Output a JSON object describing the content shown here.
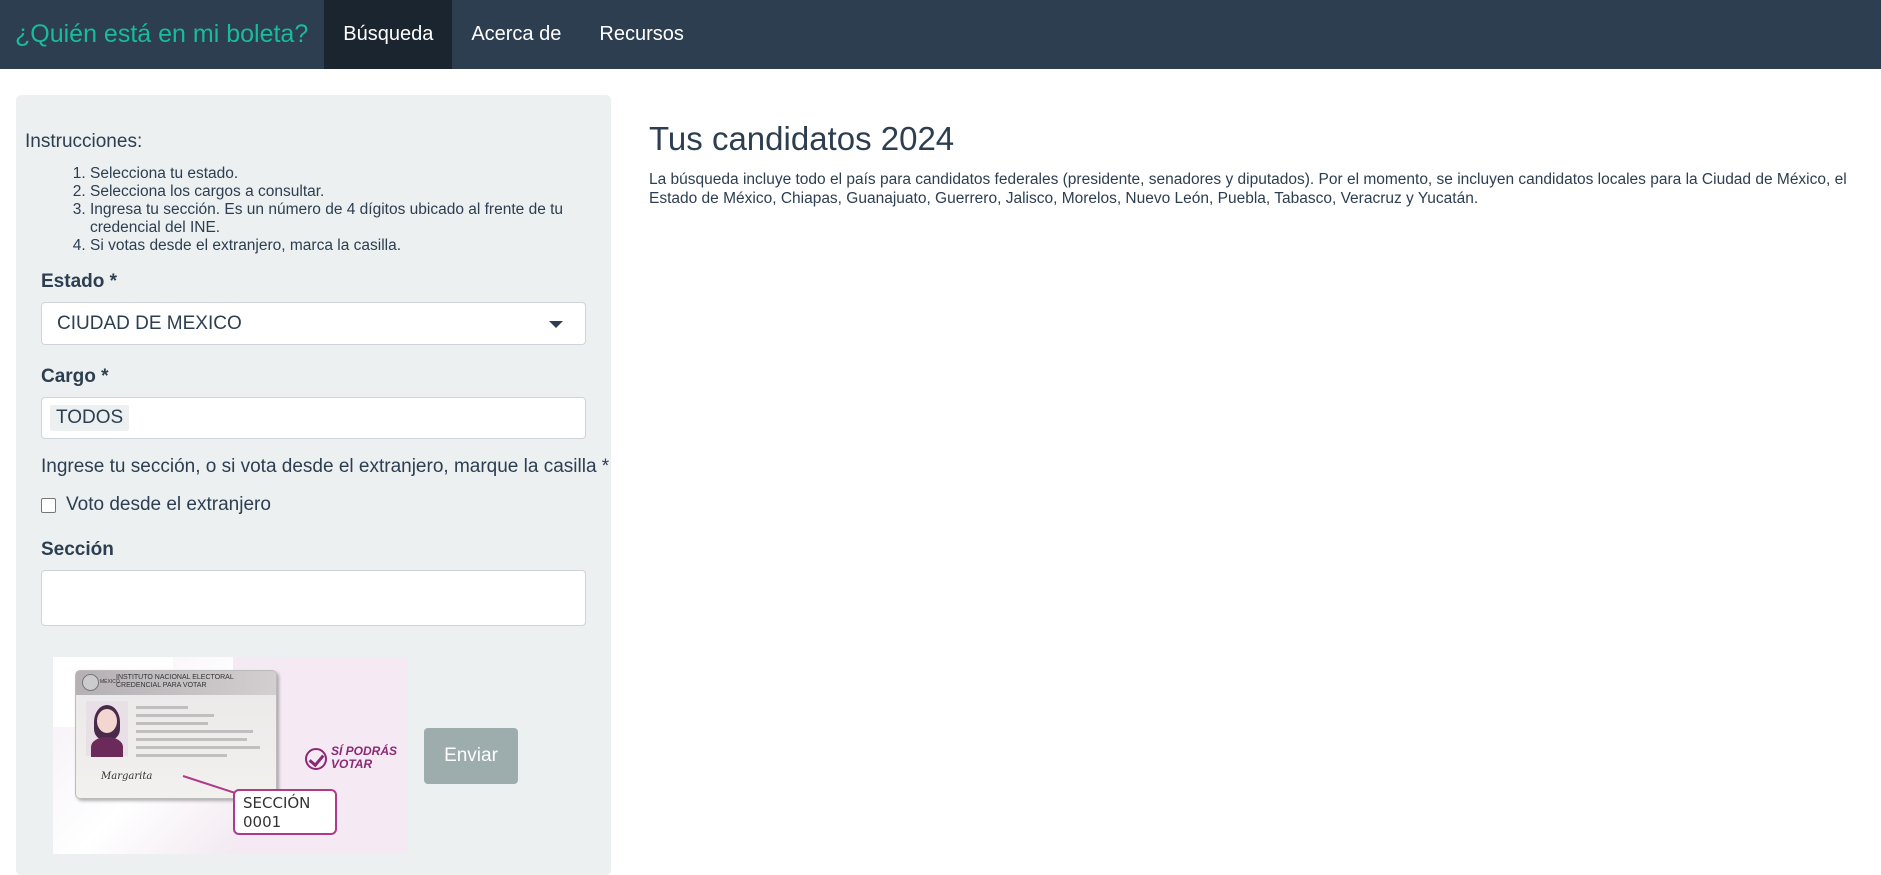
{
  "navbar": {
    "brand": "¿Quién está en mi boleta?",
    "items": [
      {
        "label": "Búsqueda",
        "active": true
      },
      {
        "label": "Acerca de",
        "active": false
      },
      {
        "label": "Recursos",
        "active": false
      }
    ]
  },
  "sidebar": {
    "instructions_title": "Instrucciones:",
    "steps": [
      "Selecciona tu estado.",
      "Selecciona los cargos a consultar.",
      "Ingresa tu sección. Es un número de 4 dígitos ubicado al frente de tu credencial del INE.",
      "Si votas desde el extranjero, marca la casilla."
    ],
    "estado": {
      "label": "Estado *",
      "value": "CIUDAD DE MEXICO"
    },
    "cargo": {
      "label": "Cargo *",
      "value": "TODOS"
    },
    "hint": "Ingrese tu sección, o si vota desde el extranjero, marque la casilla *",
    "extranjero": {
      "label": "Voto desde el extranjero",
      "checked": false
    },
    "seccion": {
      "label": "Sección",
      "value": "",
      "placeholder": ""
    },
    "ine_image": {
      "card_country": "MÉXICO",
      "card_title": "INSTITUTO NACIONAL ELECTORAL",
      "card_subtitle": "CREDENCIAL PARA VOTAR",
      "callout": "SECCIÓN\n0001",
      "callout_line1": "SECCIÓN",
      "callout_line2": "0001",
      "slogan_line1": "SÍ PODRÁS",
      "slogan_line2": "VOTAR"
    },
    "submit": "Enviar"
  },
  "main": {
    "title": "Tus candidatos 2024",
    "description": "La búsqueda incluye todo el país para candidatos federales (presidente, senadores y diputados). Por el momento, se incluyen candidatos locales para la Ciudad de México, el Estado de México, Chiapas, Guanajuato, Guerrero, Jalisco, Morelos, Nuevo León, Puebla, Tabasco, Veracruz y Yucatán."
  },
  "colors": {
    "navbar_bg": "#2c3e50",
    "brand": "#18bc9c",
    "active_tab_bg": "#1a252f",
    "panel_bg": "#ecf0f1",
    "button_disabled": "#95a5a6",
    "accent_purple": "#8b2a74"
  }
}
